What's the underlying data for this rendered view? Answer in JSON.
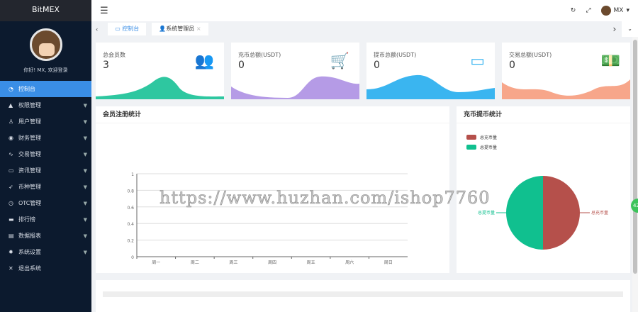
{
  "brand": "BitMEX",
  "welcome": "你好! MX, 欢迎登录",
  "nav": [
    {
      "label": "控制台",
      "icon": "dashboard-icon"
    },
    {
      "label": "权限管理",
      "icon": "users-icon"
    },
    {
      "label": "用户管理",
      "icon": "user-icon"
    },
    {
      "label": "财务管理",
      "icon": "finance-icon"
    },
    {
      "label": "交易管理",
      "icon": "pulse-icon"
    },
    {
      "label": "资讯管理",
      "icon": "news-icon"
    },
    {
      "label": "币种管理",
      "icon": "send-icon"
    },
    {
      "label": "OTC管理",
      "icon": "clock-icon"
    },
    {
      "label": "排行榜",
      "icon": "chat-icon"
    },
    {
      "label": "数据报表",
      "icon": "report-icon"
    },
    {
      "label": "系统设置",
      "icon": "gear-icon"
    },
    {
      "label": "退出系统",
      "icon": "close-icon"
    }
  ],
  "header": {
    "user": "MX"
  },
  "tabs": [
    {
      "label": "控制台"
    },
    {
      "label": "系统管理员"
    }
  ],
  "cards": [
    {
      "label": "总会员数",
      "value": "3",
      "color": "#2ec7a0"
    },
    {
      "label": "充币总额(USDT)",
      "value": "0",
      "color": "#b59be6"
    },
    {
      "label": "提币总额(USDT)",
      "value": "0",
      "color": "#3ab5f0"
    },
    {
      "label": "交易总额(USDT)",
      "value": "0",
      "color": "#f7a68a"
    }
  ],
  "watermark": "https://www.huzhan.com/ishop7760",
  "badge": "42",
  "chart_data": [
    {
      "type": "line",
      "title": "会员注册统计",
      "categories": [
        "周一",
        "周二",
        "周三",
        "周四",
        "周五",
        "周六",
        "周日"
      ],
      "series": [],
      "ylim": [
        0,
        1
      ],
      "yticks": [
        "0",
        "0.2",
        "0.4",
        "0.6",
        "0.8",
        "1"
      ],
      "grid": true
    },
    {
      "type": "pie",
      "title": "充币提币统计",
      "legend": [
        "总充币量",
        "总提币量"
      ],
      "legend_position": "top-left",
      "slices": [
        {
          "name": "总充币量",
          "value": 50,
          "color": "#b5504b"
        },
        {
          "name": "总提币量",
          "value": 50,
          "color": "#10c08f"
        }
      ]
    }
  ]
}
